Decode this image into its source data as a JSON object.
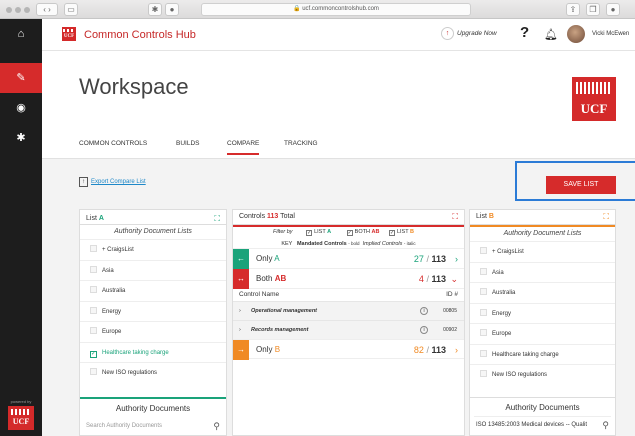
{
  "browser": {
    "url": "ucf.commoncontrolshub.com",
    "tab_icons": [
      "star-icon",
      "info-icon"
    ]
  },
  "brand": {
    "name": "Common Controls Hub",
    "logo_text": "UCF"
  },
  "rail": {
    "powered_by": "powered by",
    "logo_text": "UCF"
  },
  "header": {
    "upgrade": "Upgrade Now",
    "help": "?",
    "user": "Vicki McEwen"
  },
  "page": {
    "title": "Workspace"
  },
  "tabs": [
    {
      "label": "COMMON CONTROLS"
    },
    {
      "label": "BUILDS"
    },
    {
      "label": "COMPARE"
    },
    {
      "label": "TRACKING"
    }
  ],
  "actions": {
    "export": "Export Compare List",
    "save": "SAVE LIST"
  },
  "list_a": {
    "title_prefix": "List",
    "title_letter": "A",
    "subtitle": "Authority Document Lists",
    "items": [
      {
        "label": "+ CraigsList",
        "checked": false
      },
      {
        "label": "Asia",
        "checked": false
      },
      {
        "label": "Australia",
        "checked": false
      },
      {
        "label": "Energy",
        "checked": false
      },
      {
        "label": "Europe",
        "checked": false
      },
      {
        "label": "Healthcare taking charge",
        "checked": true
      },
      {
        "label": "New ISO regulations",
        "checked": false
      }
    ],
    "ad_title": "Authority Documents",
    "search_placeholder": "Search Authority Documents"
  },
  "list_b": {
    "title_prefix": "List",
    "title_letter": "B",
    "subtitle": "Authority Document Lists",
    "items": [
      {
        "label": "+ CraigsList"
      },
      {
        "label": "Asia"
      },
      {
        "label": "Australia"
      },
      {
        "label": "Energy"
      },
      {
        "label": "Europe"
      },
      {
        "label": "Healthcare taking charge"
      },
      {
        "label": "New ISO regulations"
      }
    ],
    "ad_title": "Authority Documents",
    "search_value": "ISO 13485:2003 Medical devices -- Qualit"
  },
  "controls": {
    "title": "Controls",
    "count": "113",
    "total_label": "Total",
    "filter_by": "Filter by",
    "filters": {
      "list_prefix": "LIST",
      "a": "A",
      "both_prefix": "BOTH",
      "both": "AB",
      "b": "B"
    },
    "key": {
      "prefix": "KEY",
      "mandated": "Mandated Controls",
      "mandated_note": "- bold",
      "implied": "Implied Controls",
      "implied_note": "- italic"
    },
    "only_a": {
      "label": "Only",
      "letter": "A",
      "count": "27",
      "total": "113",
      "arrow": "←"
    },
    "both": {
      "label": "Both",
      "letter": "AB",
      "count": "4",
      "total": "113",
      "arrow": "↔"
    },
    "only_b": {
      "label": "Only",
      "letter": "B",
      "count": "82",
      "total": "113",
      "arrow": "→"
    },
    "col_name": "Control Name",
    "col_id": "ID #",
    "rows": [
      {
        "name": "Operational management",
        "id": "00805"
      },
      {
        "name": "Records management",
        "id": "00902"
      }
    ],
    "separator": "/"
  },
  "colors": {
    "red": "#d62b2b",
    "teal": "#1aa37a",
    "orange": "#f08a24",
    "blue": "#2b7bd6"
  }
}
